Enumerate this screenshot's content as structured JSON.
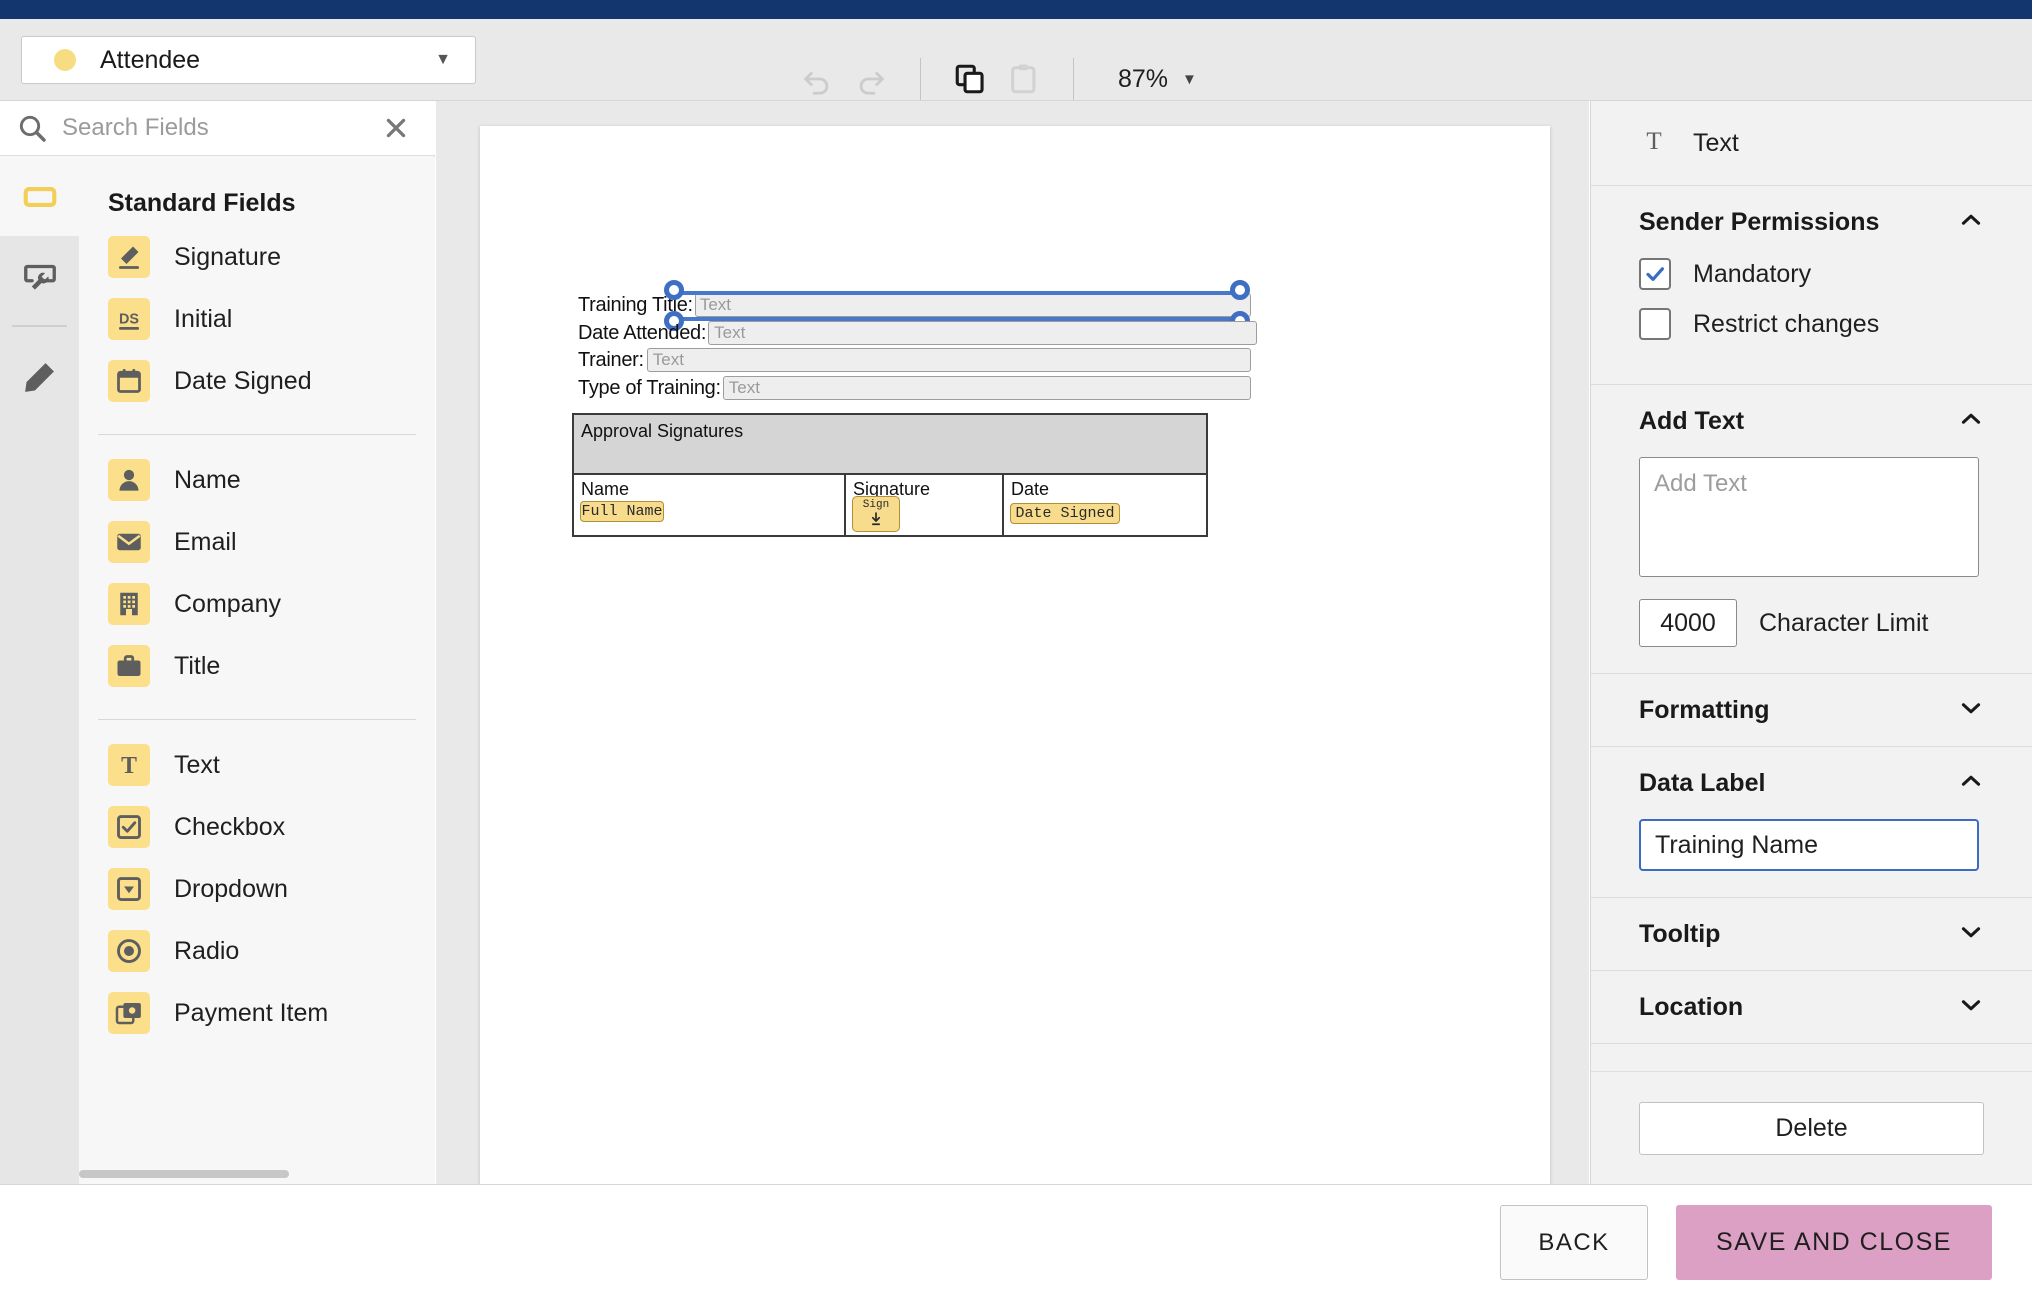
{
  "topbar": {
    "color": "#14366e"
  },
  "toolbar": {
    "recipient": {
      "label": "Attendee",
      "dot_color": "#f7dd82",
      "caret": "▼"
    },
    "undo_label": "undo-icon",
    "redo_label": "redo-icon",
    "copy_label": "copy-icon",
    "paste_label": "paste-icon",
    "zoom_value": "87%",
    "zoom_caret": "▼"
  },
  "sidebar": {
    "search": {
      "placeholder": "Search Fields",
      "value": ""
    },
    "rail": [
      {
        "name": "fields-tool",
        "icon": "rectangle-field-icon",
        "active": true
      },
      {
        "name": "settings-tool",
        "icon": "wrench-screen-icon",
        "active": false
      },
      {
        "name": "draw-tool",
        "icon": "pencil-icon",
        "active": false
      }
    ],
    "title": "Standard Fields",
    "groups": [
      {
        "items": [
          {
            "label": "Signature",
            "icon": "signature-pen-icon"
          },
          {
            "label": "Initial",
            "icon": "initial-ds-icon"
          },
          {
            "label": "Date Signed",
            "icon": "calendar-icon"
          }
        ]
      },
      {
        "items": [
          {
            "label": "Name",
            "icon": "person-icon"
          },
          {
            "label": "Email",
            "icon": "envelope-icon"
          },
          {
            "label": "Company",
            "icon": "building-icon"
          },
          {
            "label": "Title",
            "icon": "briefcase-icon"
          }
        ]
      },
      {
        "items": [
          {
            "label": "Text",
            "icon": "text-t-icon"
          },
          {
            "label": "Checkbox",
            "icon": "checkbox-icon"
          },
          {
            "label": "Dropdown",
            "icon": "dropdown-icon"
          },
          {
            "label": "Radio",
            "icon": "radio-icon"
          },
          {
            "label": "Payment Item",
            "icon": "payment-icon"
          }
        ]
      }
    ]
  },
  "document": {
    "lines": [
      {
        "label": "Training Title:",
        "placeholder": "Text",
        "selected": true
      },
      {
        "label": "Date Attended:",
        "placeholder": "Text",
        "selected": false
      },
      {
        "label": "Trainer:",
        "placeholder": "Text",
        "selected": false
      },
      {
        "label": "Type of Training:",
        "placeholder": "Text",
        "selected": false
      }
    ],
    "table": {
      "header": "Approval Signatures",
      "columns": [
        {
          "header": "Name",
          "tag": "Full Name",
          "tag_type": "text"
        },
        {
          "header": "Signature",
          "tag": "Sign",
          "tag_type": "sign"
        },
        {
          "header": "Date",
          "tag": "Date Signed",
          "tag_type": "text"
        }
      ]
    }
  },
  "right_panel": {
    "header": {
      "label": "Text",
      "icon": "text-t-icon"
    },
    "sections": {
      "sender_permissions": {
        "title": "Sender Permissions",
        "expanded": true,
        "chevron": "⌃",
        "checkboxes": [
          {
            "label": "Mandatory",
            "checked": true
          },
          {
            "label": "Restrict changes",
            "checked": false
          }
        ]
      },
      "add_text": {
        "title": "Add Text",
        "expanded": true,
        "textarea_placeholder": "Add Text",
        "textarea_value": "",
        "char_limit_value": "4000",
        "char_limit_label": "Character Limit"
      },
      "formatting": {
        "title": "Formatting",
        "expanded": false
      },
      "data_label": {
        "title": "Data Label",
        "expanded": true,
        "value": "Training Name"
      },
      "tooltip": {
        "title": "Tooltip",
        "expanded": false
      },
      "location": {
        "title": "Location",
        "expanded": false
      }
    },
    "delete_label": "Delete"
  },
  "footer": {
    "back_label": "BACK",
    "save_label": "SAVE AND CLOSE",
    "save_color": "#dda0c5"
  }
}
